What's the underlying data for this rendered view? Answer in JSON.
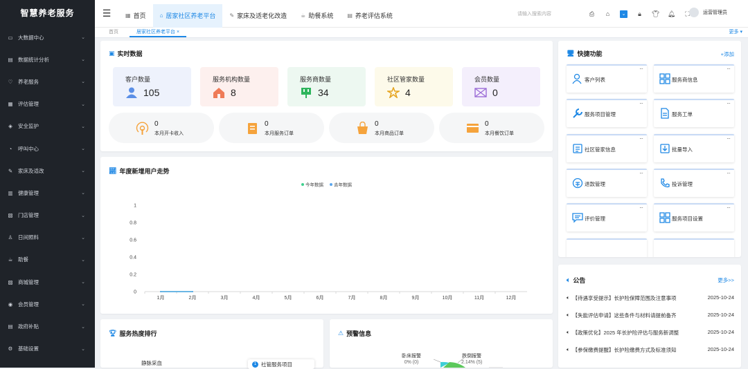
{
  "app": {
    "title": "智慧养老服务"
  },
  "sidebar": {
    "items": [
      {
        "label": "大数据中心",
        "icon": "monitor-icon"
      },
      {
        "label": "数据统计分析",
        "icon": "chart-icon"
      },
      {
        "label": "养老服务",
        "icon": "heart-icon"
      },
      {
        "label": "评估管理",
        "icon": "clipboard-icon"
      },
      {
        "label": "安全监护",
        "icon": "shield-icon"
      },
      {
        "label": "呼叫中心",
        "icon": "bell-icon"
      },
      {
        "label": "家床及适改",
        "icon": "tools-icon"
      },
      {
        "label": "健康管理",
        "icon": "health-icon"
      },
      {
        "label": "门店管理",
        "icon": "store-icon"
      },
      {
        "label": "日间照料",
        "icon": "person-icon"
      },
      {
        "label": "助餐",
        "icon": "meal-icon"
      },
      {
        "label": "商城管理",
        "icon": "shop-icon"
      },
      {
        "label": "会员管理",
        "icon": "member-icon"
      },
      {
        "label": "政府补贴",
        "icon": "document-icon"
      },
      {
        "label": "基础设置",
        "icon": "gear-icon"
      }
    ]
  },
  "topnav": {
    "tabs": [
      {
        "label": "首页",
        "icon": "grid-icon"
      },
      {
        "label": "居家社区养老平台",
        "icon": "home-icon"
      },
      {
        "label": "家床及适老化改造",
        "icon": "tools-icon"
      },
      {
        "label": "助餐系统",
        "icon": "meal-icon"
      },
      {
        "label": "养老评估系统",
        "icon": "document-icon"
      }
    ],
    "search_placeholder": "请输入搜索内容",
    "user": "运营管理员"
  },
  "subtabs": {
    "home": "首页",
    "active": "居家社区养老平台",
    "close": "×",
    "more": "更多"
  },
  "realtime": {
    "title": "实时数据",
    "stats": [
      {
        "label": "客户数量",
        "value": "105",
        "bg": "#eef2fc"
      },
      {
        "label": "服务机构数量",
        "value": "8",
        "bg": "#fdf0ee"
      },
      {
        "label": "服务商数量",
        "value": "34",
        "bg": "#edf8f1"
      },
      {
        "label": "社区管家数量",
        "value": "4",
        "bg": "#fdfaea"
      },
      {
        "label": "会员数量",
        "value": "0",
        "bg": "#f4effc"
      }
    ],
    "pills": [
      {
        "value": "0",
        "label": "本月开卡收入"
      },
      {
        "value": "0",
        "label": "本月服务订单"
      },
      {
        "value": "0",
        "label": "本月商品订单"
      },
      {
        "value": "0",
        "label": "本月餐饮订单"
      }
    ]
  },
  "trend": {
    "title": "年度新增用户走势"
  },
  "chart_data": {
    "type": "line",
    "title": "",
    "categories": [
      "1月",
      "2月",
      "3月",
      "4月",
      "5月",
      "6月",
      "7月",
      "8月",
      "9月",
      "10月",
      "11月",
      "12月"
    ],
    "series": [
      {
        "name": "今年数据",
        "color": "#3fd08f",
        "values": [
          0,
          0,
          null,
          null,
          null,
          null,
          null,
          null,
          null,
          null,
          null,
          null
        ]
      },
      {
        "name": "去年数据",
        "color": "#5aa6ee",
        "values": [
          0,
          0,
          null,
          null,
          null,
          null,
          null,
          null,
          null,
          null,
          null,
          null
        ]
      }
    ],
    "yticks": [
      "0",
      "0.2",
      "0.4",
      "0.6",
      "0.8",
      "1"
    ],
    "ylim": [
      0,
      1
    ],
    "grid": false,
    "legend": "top-center"
  },
  "quick": {
    "title": "快捷功能",
    "add": "+添加",
    "dots": "···",
    "items": [
      {
        "label": "客户列表",
        "icon": "users-icon"
      },
      {
        "label": "服务商信息",
        "icon": "apps-icon"
      },
      {
        "label": "服务项目管理",
        "icon": "wrench-icon"
      },
      {
        "label": "服务工单",
        "icon": "file-icon"
      },
      {
        "label": "社区管家信息",
        "icon": "list-icon"
      },
      {
        "label": "批量导入",
        "icon": "import-icon"
      },
      {
        "label": "退款管理",
        "icon": "refund-icon"
      },
      {
        "label": "投诉管理",
        "icon": "phone-icon"
      },
      {
        "label": "评价管理",
        "icon": "comment-icon"
      },
      {
        "label": "服务项目设置",
        "icon": "apps-icon"
      }
    ]
  },
  "notice": {
    "title": "公告",
    "more": "更多>>",
    "items": [
      {
        "text": "【待遇享受提示】长护险保障范围及注意事项",
        "date": "2025-10-24"
      },
      {
        "text": "【失能评估申请】这些条件与材料请提前备齐",
        "date": "2025-10-24"
      },
      {
        "text": "【政策优化】2025 年长护险评估与服务新调整",
        "date": "2025-10-24"
      },
      {
        "text": "【参保缴费提醒】长护险缴费方式及标准须知",
        "date": "2025-10-24"
      }
    ]
  },
  "ranking": {
    "title": "服务热度排行",
    "label1": "静脉采血",
    "badge": "1",
    "label2": "社管服务项目"
  },
  "warning": {
    "title": "预警信息",
    "labels": [
      {
        "name": "卧床报警",
        "value": "0% (0)"
      },
      {
        "name": "跌倒报警",
        "value": "2.14% (5)"
      }
    ]
  }
}
